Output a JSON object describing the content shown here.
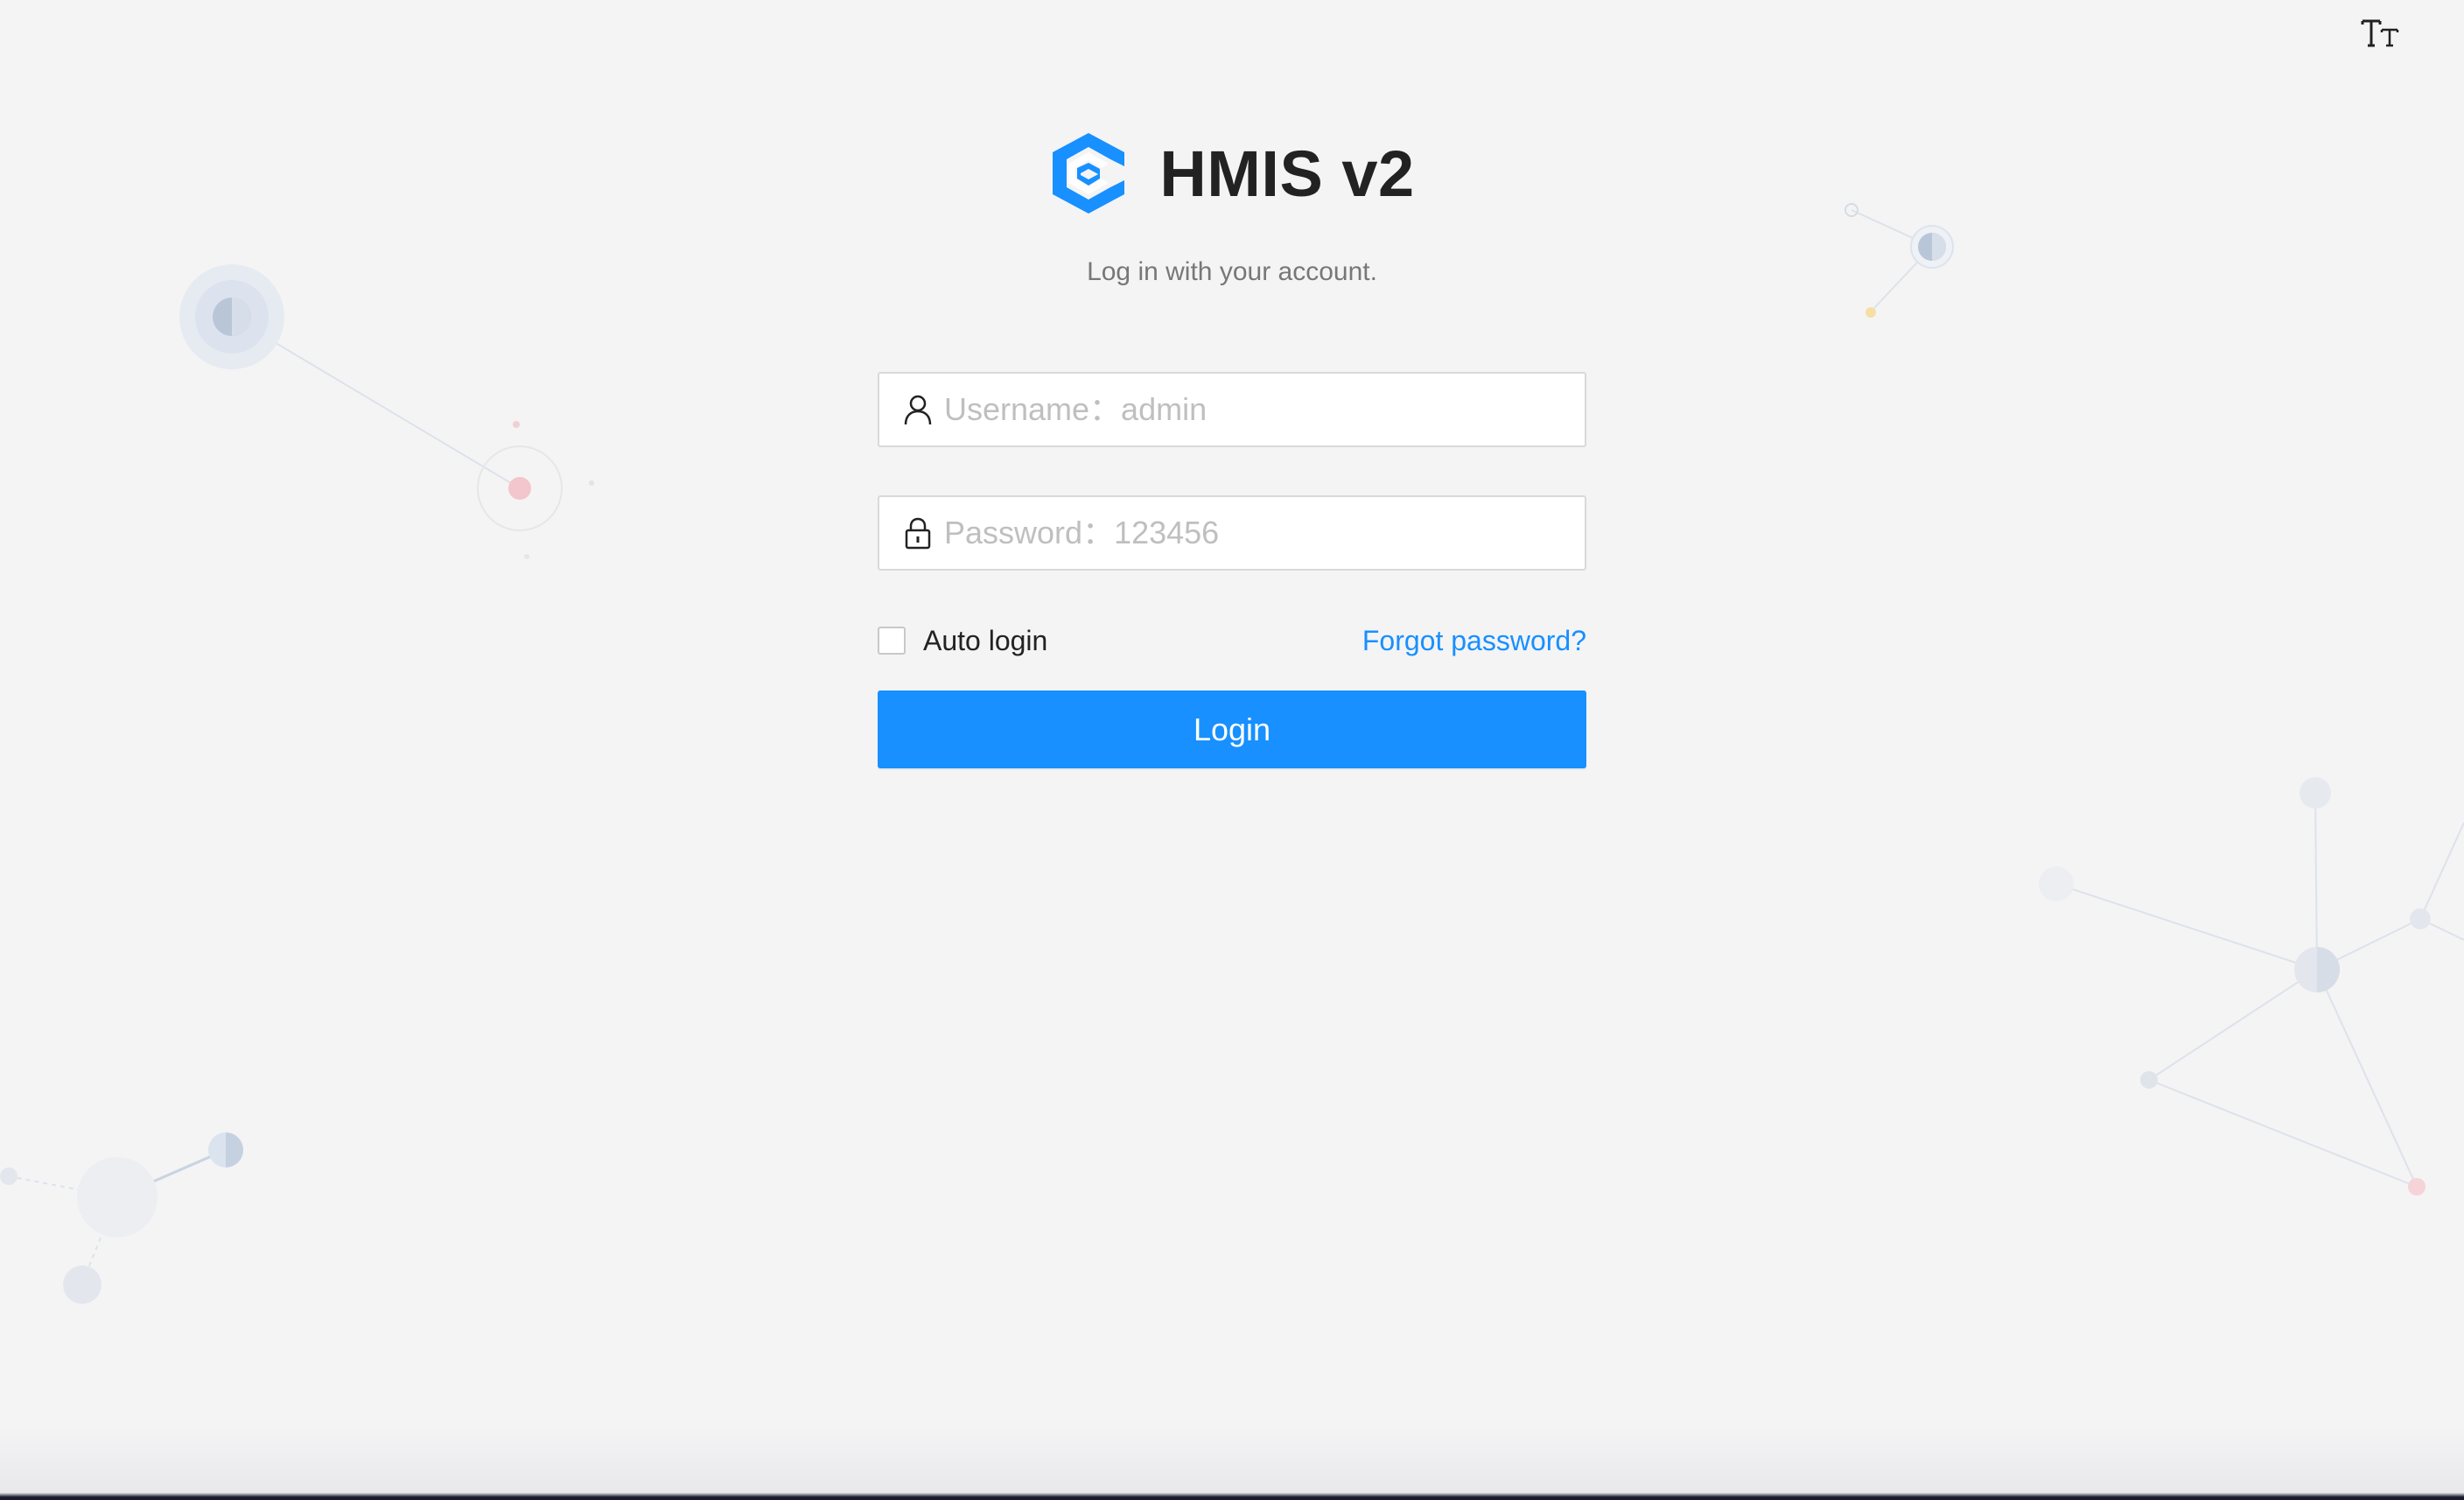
{
  "app": {
    "title": "HMIS v2",
    "subtitle": "Log in with your account."
  },
  "toolbar": {
    "font_toggle_icon": "font-size-icon"
  },
  "form": {
    "username": {
      "placeholder": "Username：admin",
      "value": "",
      "icon": "user-icon"
    },
    "password": {
      "placeholder": "Password：123456",
      "value": "",
      "icon": "lock-icon"
    },
    "auto_login_label": "Auto login",
    "auto_login_checked": false,
    "forgot_password_label": "Forgot password?",
    "login_label": "Login"
  },
  "colors": {
    "primary": "#1890ff",
    "background": "#f4f4f5",
    "title": "#222222",
    "subtitle": "#777777"
  }
}
